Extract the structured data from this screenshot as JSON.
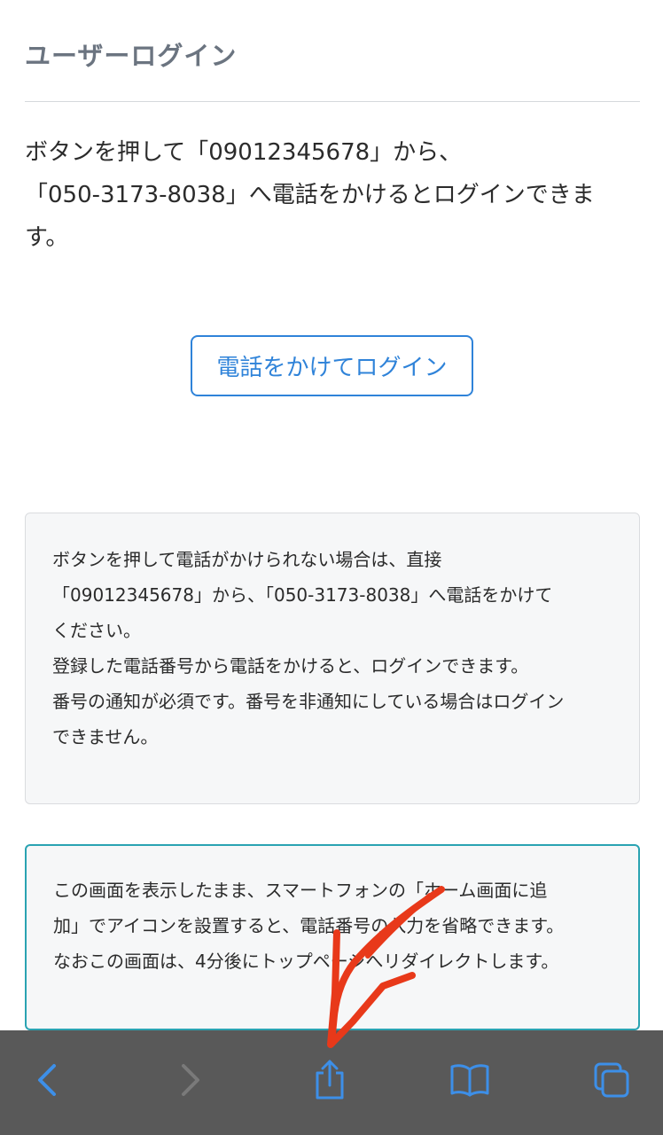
{
  "page": {
    "title": "ユーザーログイン"
  },
  "intro": {
    "lines": [
      "ボタンを押して「09012345678」から、",
      "「050-3173-8038」へ電話をかけるとログインできま",
      "す。"
    ]
  },
  "call_button": {
    "label": "電話をかけてログイン"
  },
  "notice": {
    "lines": [
      "ボタンを押して電話がかけられない場合は、直接",
      "「09012345678」から、「050-3173-8038」へ電話をかけて",
      "ください。",
      "登録した電話番号から電話をかけると、ログインできます。",
      "番号の通知が必須です。番号を非通知にしている場合はログイン",
      "できません。"
    ]
  },
  "home_notice": {
    "lines": [
      "この画面を表示したまま、スマートフォンの「ホーム画面に追",
      "加」でアイコンを設置すると、電話番号の入力を省略できます。",
      "なおこの画面は、4分後にトップページへリダイレクトします。"
    ]
  },
  "toolbar": {
    "items": [
      {
        "icon": "back-chevron-icon"
      },
      {
        "icon": "forward-chevron-icon"
      },
      {
        "icon": "share-icon"
      },
      {
        "icon": "bookmarks-icon"
      },
      {
        "icon": "tabs-icon"
      }
    ]
  },
  "colors": {
    "accent": "#2f83d9",
    "title_gray": "#6b7480",
    "home_border": "#2aa3b2",
    "toolbar_bg": "#595959",
    "toolbar_icon": "#3d8fe8",
    "arrow": "#e8391a"
  }
}
